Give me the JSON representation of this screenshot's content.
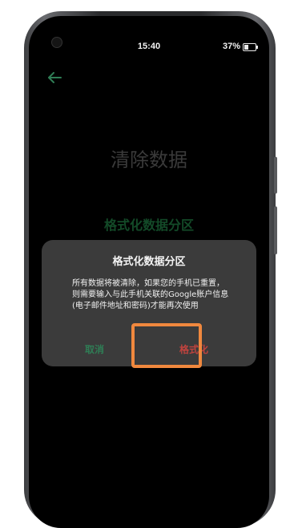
{
  "status_bar": {
    "time": "15:40",
    "battery": "37%"
  },
  "nav": {
    "back_icon": "arrow-left-icon"
  },
  "page": {
    "title": "清除数据",
    "section_title": "格式化数据分区"
  },
  "dialog": {
    "title": "格式化数据分区",
    "message": "所有数据将被清除，如果您的手机已重置，则需要输入与此手机关联的Google账户信息(电子邮件地址和密码)才能再次使用",
    "cancel_label": "取消",
    "confirm_label": "格式化"
  },
  "colors": {
    "screen_bg": "#000000",
    "dialog_bg": "#3b3b3b",
    "accent_green": "#2f7d55",
    "danger_red": "#c0433e",
    "highlight": "#f0883e"
  }
}
